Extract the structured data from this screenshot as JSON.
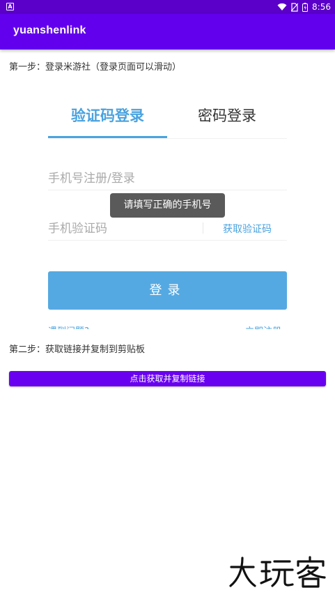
{
  "status_bar": {
    "notification_icon_letter": "A",
    "time": "8:56",
    "icons": [
      "wifi-icon",
      "no-sim-icon",
      "battery-icon"
    ]
  },
  "app_bar": {
    "title": "yuanshenlink"
  },
  "step1": {
    "text": "第一步：登录米游社（登录页面可以滑动）"
  },
  "login": {
    "tabs": [
      {
        "label": "验证码登录",
        "selected": true
      },
      {
        "label": "密码登录",
        "selected": false
      }
    ],
    "phone_placeholder": "手机号注册/登录",
    "code_placeholder": "手机验证码",
    "get_code_label": "获取验证码",
    "login_button_label": "登录",
    "help_link": "遇到问题?",
    "register_link": "立即注册"
  },
  "toast": {
    "text": "请填写正确的手机号"
  },
  "step2": {
    "text": "第二步：获取链接并复制到剪贴板",
    "button_label": "点击获取并复制链接"
  },
  "watermark": {
    "text": "大玩客"
  },
  "colors": {
    "status_bar": "#5a00c8",
    "app_bar": "#6200ee",
    "accent_blue": "#4aa3df",
    "login_button": "#55a9e2",
    "copy_button": "#6a00f0",
    "toast_bg": "#5a5a5a"
  }
}
